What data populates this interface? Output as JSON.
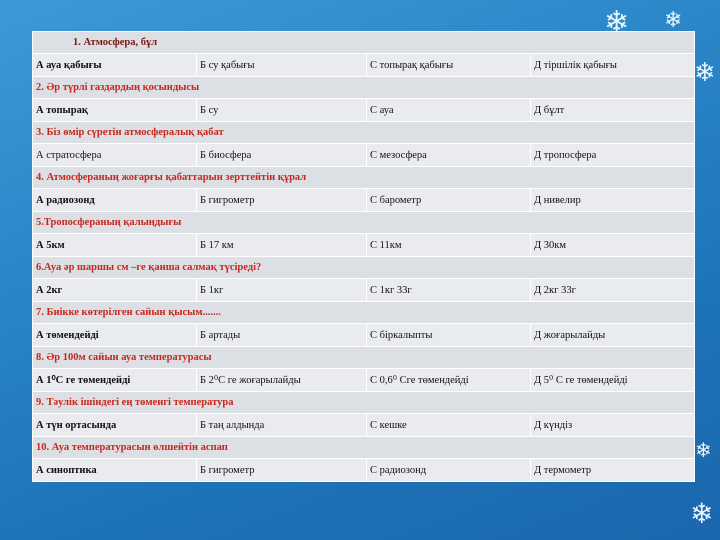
{
  "questions": [
    {
      "question": "1. Атмосфера,  бұл",
      "answers": [
        "А ауа қабығы",
        "Б су  қабығы",
        "С топырақ қабығы",
        "Д тіршілік  қабығы"
      ],
      "bold_first": true
    },
    {
      "question": "2.  Әр   түрлі   газдардың  қосындысы",
      "answers": [
        "А  топырақ",
        "Б  су",
        "С ауа",
        "Д  бұлт"
      ],
      "bold_first": true
    },
    {
      "question": "3. Біз   өмір   сүретін   атмосфералық   қабат",
      "answers": [
        "А  стратосфера",
        "Б биосфера",
        "С мезосфера",
        "Д тропосфера"
      ],
      "bold_first": false
    },
    {
      "question": "4. Атмосфераның   жоғарғы   қабаттарын   зерттейтін   құрал",
      "answers": [
        "А радиозонд",
        "Б  гигрометр",
        "С  барометр",
        "Д  нивелир"
      ],
      "bold_first": true
    },
    {
      "question": "5.Тропосфераның   қалыңдығы",
      "answers": [
        "А  5км",
        "Б 17 км",
        "С 11км",
        "Д 30км"
      ],
      "bold_first": true
    },
    {
      "question": "6.Ауа   әр   шаршы   см –ге   қанша   салмақ   түсіреді?",
      "answers": [
        "А  2кг",
        "Б  1кг",
        "С 1кг 33г",
        "Д  2кг 33г"
      ],
      "bold_first": true
    },
    {
      "question": "7. Биікке   көтерілген  сайын  қысым.......",
      "answers": [
        "А  төмендейді",
        "Б артады",
        "С біркалыпты",
        "Д жоғарылайды"
      ],
      "bold_first": true
    },
    {
      "question": "8. Әр  100м  сайын   ауа   температурасы",
      "answers": [
        "А 1⁰С ге төмендейді",
        "Б 2⁰С ге жоғарылайды",
        "С 0,6⁰ Сге   төмендейді",
        "Д 5⁰ С ге   төмендейді"
      ],
      "bold_first": true
    },
    {
      "question": "9.  Тәулік   ішіндегі   ең   төменгі   температура",
      "answers": [
        "А  түн  ортасында",
        "Б таң  алдында",
        "С кешке",
        "Д күндіз"
      ],
      "bold_first": true
    },
    {
      "question": "10.  Ауа  температурасын   өлшейтін   аспап",
      "answers": [
        "А  синоптика",
        "Б гигрометр",
        "С  радиозонд",
        "Д термометр"
      ],
      "bold_first": true
    }
  ],
  "decor": {
    "snowflake_icon": "snowflake-icon"
  }
}
